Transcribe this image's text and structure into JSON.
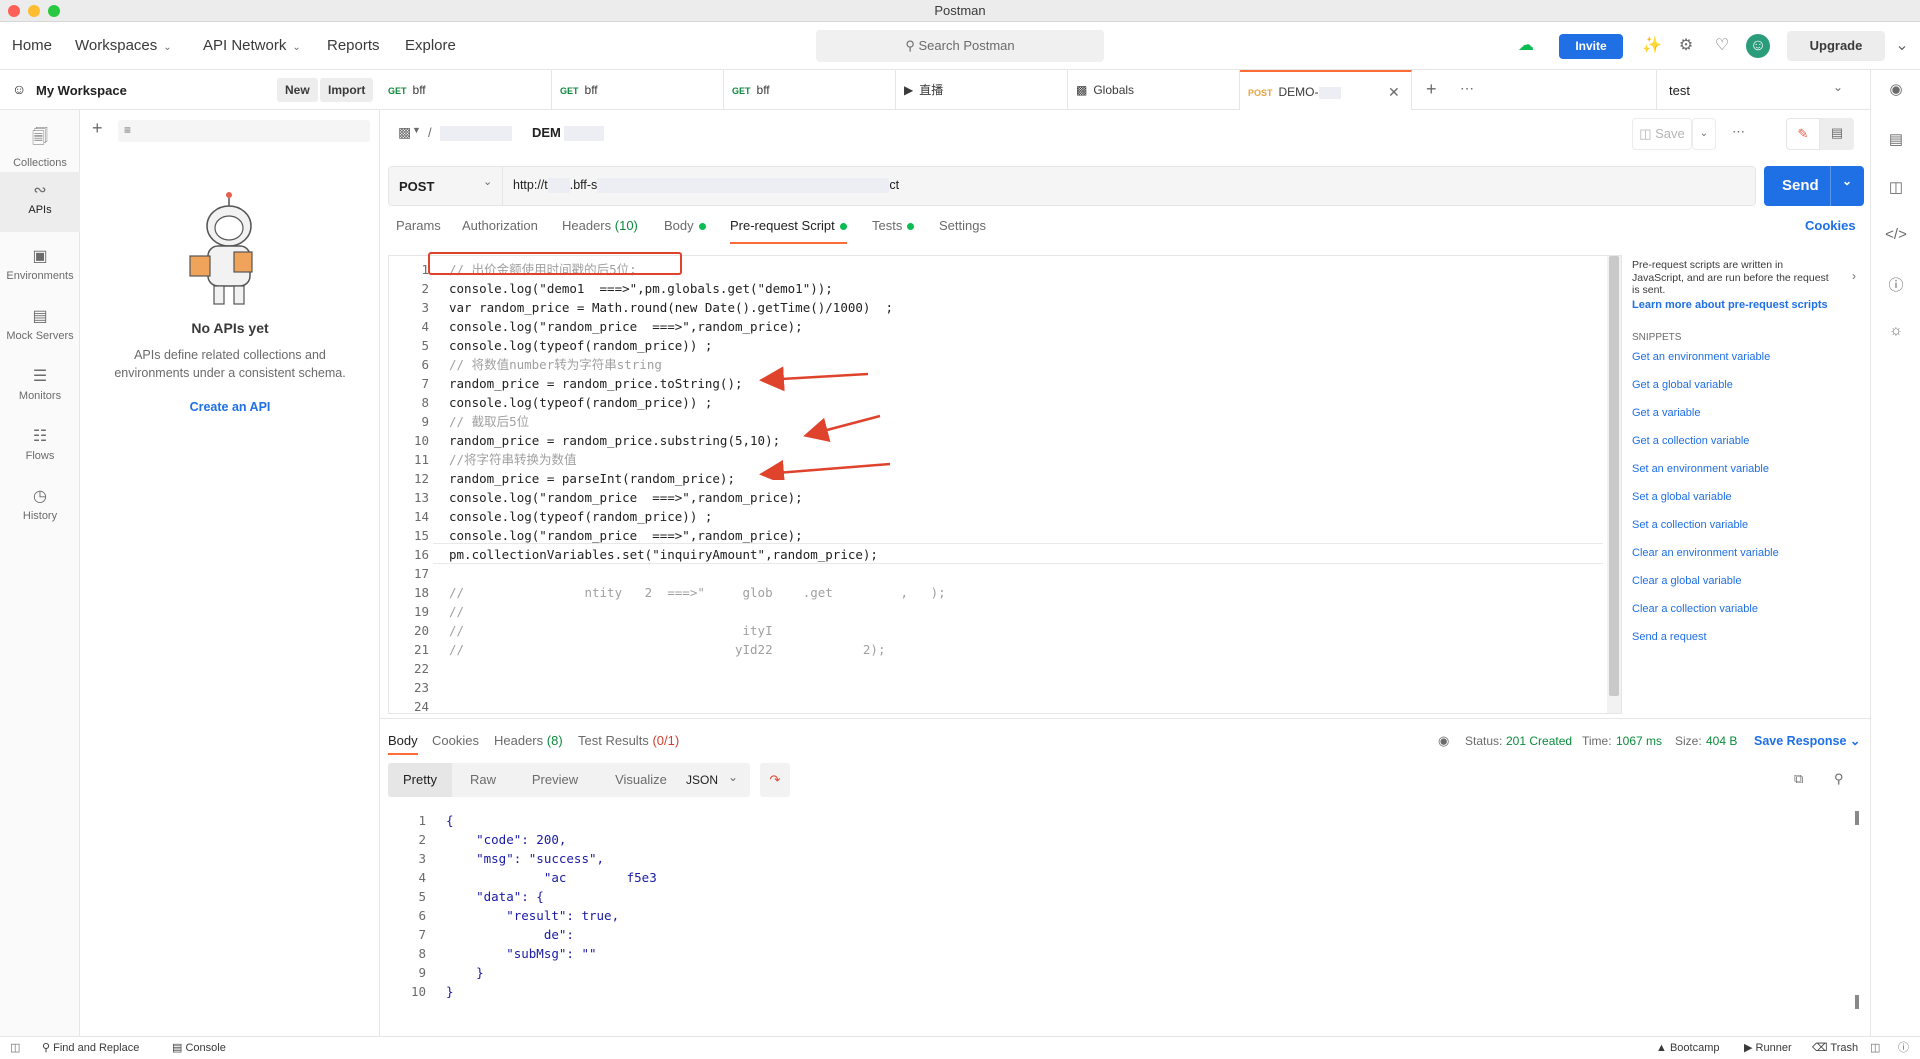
{
  "window": {
    "title": "Postman"
  },
  "header": {
    "nav": [
      "Home",
      "Workspaces",
      "API Network",
      "Reports",
      "Explore"
    ],
    "search_placeholder": "Search Postman",
    "invite": "Invite",
    "upgrade": "Upgrade"
  },
  "workspace": {
    "name": "My Workspace",
    "new": "New",
    "import": "Import"
  },
  "rail": [
    "Collections",
    "APIs",
    "Environments",
    "Mock Servers",
    "Monitors",
    "Flows",
    "History"
  ],
  "sidebar": {
    "empty_title": "No APIs yet",
    "empty_desc_1": "APIs define related collections and",
    "empty_desc_2": "environments under a consistent schema.",
    "create_link": "Create an API"
  },
  "tabs": [
    {
      "method": "GET",
      "name": "bff"
    },
    {
      "method": "GET",
      "name": "bff"
    },
    {
      "method": "GET",
      "name": "bff"
    },
    {
      "method": "",
      "name": "直播"
    },
    {
      "method": "",
      "name": "Globals"
    },
    {
      "method": "POST",
      "name": "DEMO-"
    }
  ],
  "environment": {
    "name": "test"
  },
  "request": {
    "breadcrumb_sep": "/",
    "name": "DEM",
    "save": "Save",
    "method": "POST",
    "url": "http://t",
    "url_mid": ".bff-s",
    "url_end": "ct",
    "send": "Send",
    "cookies": "Cookies",
    "tabs": [
      "Params",
      "Authorization",
      "Headers",
      "(10)",
      "Body",
      "Pre-request Script",
      "Tests",
      "Settings"
    ]
  },
  "script_lines": [
    "// 出价金额使用时间戳的后5位;",
    "console.log(\"demo1  ===>\",pm.globals.get(\"demo1\"));",
    "var random_price = Math.round(new Date().getTime()/1000)  ;",
    "console.log(\"random_price  ===>\",random_price);",
    "console.log(typeof(random_price)) ;",
    "// 将数值number转为字符串string",
    "random_price = random_price.toString();",
    "console.log(typeof(random_price)) ;",
    "// 截取后5位",
    "random_price = random_price.substring(5,10);",
    "//将字符串转换为数值",
    "random_price = parseInt(random_price);",
    "console.log(\"random_price  ===>\",random_price);",
    "console.log(typeof(random_price)) ;",
    "console.log(\"random_price  ===>\",random_price);",
    "pm.collectionVariables.set(\"inquiryAmount\",random_price);",
    "",
    "//                ntity   2  ===>\"     glob    .get         ,   );",
    "//",
    "//                                     ityI",
    "//                                    yId22            2);",
    "",
    "",
    ""
  ],
  "snippets": {
    "intro_1": "Pre-request scripts are written in",
    "intro_2": "JavaScript, and are run before the request",
    "intro_3": "is sent.",
    "learn": "Learn more about pre-request scripts",
    "heading": "SNIPPETS",
    "items": [
      "Get an environment variable",
      "Get a global variable",
      "Get a variable",
      "Get a collection variable",
      "Set an environment variable",
      "Set a global variable",
      "Set a collection variable",
      "Clear an environment variable",
      "Clear a global variable",
      "Clear a collection variable",
      "Send a request"
    ]
  },
  "response": {
    "tabs": [
      "Body",
      "Cookies",
      "Headers",
      "(8)",
      "Test Results",
      "(0/1)"
    ],
    "status_label": "Status:",
    "status": "201 Created",
    "time_label": "Time:",
    "time": "1067 ms",
    "size_label": "Size:",
    "size": "404 B",
    "save": "Save Response",
    "views": [
      "Pretty",
      "Raw",
      "Preview",
      "Visualize"
    ],
    "format": "JSON",
    "lines": [
      "{",
      "    \"code\": 200,",
      "    \"msg\": \"success\",",
      "             \"ac        f5e3",
      "    \"data\": {",
      "        \"result\": true,",
      "             de\":",
      "        \"subMsg\": \"\"",
      "    }",
      "}"
    ]
  },
  "footer": {
    "find": "Find and Replace",
    "console": "Console",
    "bootcamp": "Bootcamp",
    "runner": "Runner",
    "trash": "Trash"
  },
  "colors": {
    "accent": "#1f6fe5",
    "postman_orange": "#ff6c37",
    "annotation_red": "#e0432c"
  }
}
